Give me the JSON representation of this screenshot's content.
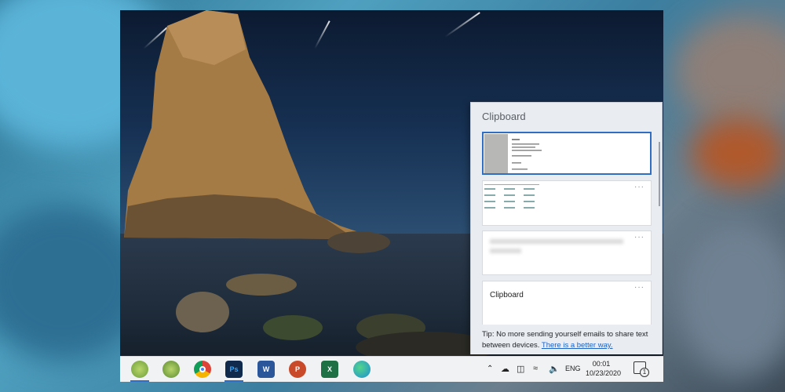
{
  "clipboard": {
    "title": "Clipboard",
    "items": [
      {
        "type": "image",
        "more": "···",
        "selected": true
      },
      {
        "type": "image",
        "more": "···",
        "selected": false
      },
      {
        "type": "blurred-text",
        "more": "···",
        "selected": false
      },
      {
        "type": "text",
        "text": "Clipboard",
        "more": "···",
        "selected": false
      }
    ],
    "tip": {
      "text": "Tip: No more sending yourself emails to share text between devices.",
      "link": "There is a better way."
    }
  },
  "taskbar": {
    "apps": [
      {
        "name": "app-1",
        "icon": "app-1-icon"
      },
      {
        "name": "app-2",
        "icon": "app-2-icon"
      },
      {
        "name": "chrome",
        "icon": "chrome-icon"
      },
      {
        "name": "photoshop",
        "label": "Ps",
        "icon": "photoshop-icon",
        "color": "#0f2a4d"
      },
      {
        "name": "word",
        "label": "W",
        "icon": "word-icon",
        "color": "#2b579a"
      },
      {
        "name": "powerpoint",
        "label": "P",
        "icon": "powerpoint-icon",
        "color": "#c94a2a"
      },
      {
        "name": "excel",
        "label": "X",
        "icon": "excel-icon",
        "color": "#1e7145"
      },
      {
        "name": "edge",
        "icon": "edge-icon",
        "color": "#1b8fd6"
      }
    ],
    "tray": {
      "chevron": "^",
      "language": "ENG",
      "time": "00:01",
      "date": "10/23/2020",
      "notification_count": "1"
    }
  },
  "colors": {
    "accent": "#2f6ec2",
    "link": "#1f63c4"
  }
}
